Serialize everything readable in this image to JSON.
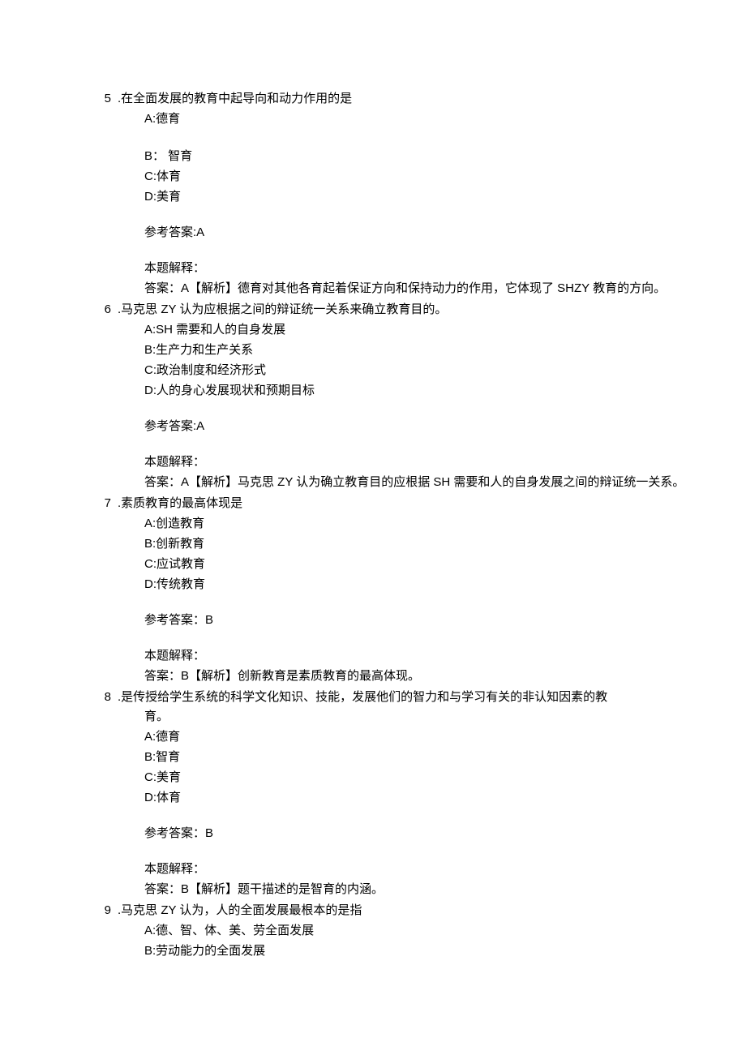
{
  "questions": [
    {
      "number": "5",
      "dot": ".",
      "stem": "在全面发展的教育中起导向和动力作用的是",
      "options": [
        "A:德育",
        "",
        "B： 智育",
        "C:体育",
        "D:美育"
      ],
      "answerLabel": "参考答案:A",
      "explainLabel": "本题解释：",
      "explainText": "答案：A【解析】德育对其他各育起着保证方向和保持动力的作用，它体现了 SHZY 教育的方向。"
    },
    {
      "number": "6",
      "dot": ".",
      "stem": "马克思 ZY 认为应根据之间的辩证统一关系来确立教育目的。",
      "options": [
        "A:SH 需要和人的自身发展",
        "B:生产力和生产关系",
        "C:政治制度和经济形式",
        "D:人的身心发展现状和预期目标"
      ],
      "answerLabel": "参考答案:A",
      "explainLabel": "本题解释：",
      "explainText": "答案：A【解析】马克思 ZY 认为确立教育目的应根据 SH 需要和人的自身发展之间的辩证统一关系。"
    },
    {
      "number": "7",
      "dot": ".",
      "stem": "素质教育的最高体现是",
      "options": [
        "A:创造教育",
        "B:创新教育",
        "C:应试教育",
        "D:传统教育"
      ],
      "answerLabel": "参考答案：B",
      "explainLabel": "本题解释：",
      "explainText": "答案：B【解析】创新教育是素质教育的最高体现。"
    },
    {
      "number": "8",
      "dot": ".",
      "stem": "是传授给学生系统的科学文化知识、技能，发展他们的智力和与学习有关的非认知因素的教",
      "stemCont": "育。",
      "options": [
        "A:德育",
        "B:智育",
        "C:美育",
        "D:体育"
      ],
      "answerLabel": "参考答案：B",
      "explainLabel": "本题解释：",
      "explainText": "答案：B【解析】题干描述的是智育的内涵。"
    },
    {
      "number": "9",
      "dot": ".",
      "stem": "马克思 ZY 认为，人的全面发展最根本的是指",
      "options": [
        "A:德、智、体、美、劳全面发展",
        "B:劳动能力的全面发展"
      ]
    }
  ]
}
